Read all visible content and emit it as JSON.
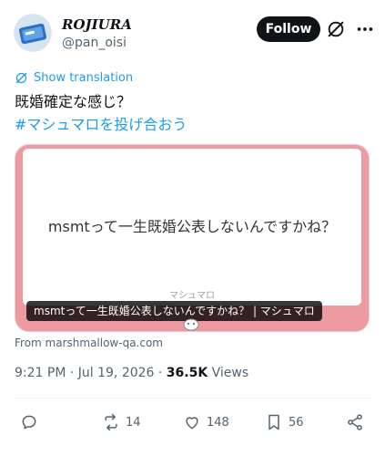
{
  "author": {
    "display_name": "ROJIURA",
    "handle": "@pan_oisi"
  },
  "header": {
    "follow_label": "Follow"
  },
  "tweet": {
    "translate_label": "Show translation",
    "text_line1": "既婚確定な感じ？",
    "hashtag": "#マシュマロを投げ合おう"
  },
  "card": {
    "question": "msmtって一生既婚公表しないんですかね？",
    "brand": "マシュマロ",
    "caption": "msmtって一生既婚公表しないんですかね？ | マシュマロ",
    "source": "From marshmallow-qa.com",
    "bg_color": "#ee9aa1"
  },
  "meta": {
    "datetime": "9:21 PM · Jul 19, 2026 · ",
    "views_count": "36.5K",
    "views_label": " Views"
  },
  "actions": {
    "replies": "",
    "reposts": "14",
    "likes": "148",
    "bookmarks": "56"
  },
  "colors": {
    "accent": "#1d9bf0",
    "text_primary": "#0f1419",
    "text_secondary": "#536471",
    "follow_bg": "#0f1419"
  }
}
